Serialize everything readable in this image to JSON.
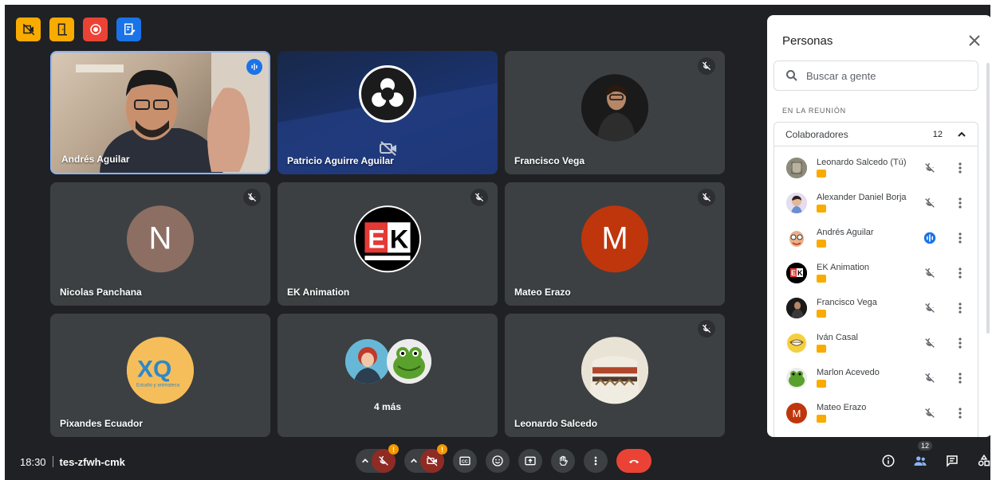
{
  "colors": {
    "tile_bg": "#3c4043",
    "meet_bg": "#202124",
    "accent_blue": "#1a73e8",
    "hangup_red": "#ea4335",
    "mic_off_red": "#8e2b25",
    "badge_orange": "#f29900",
    "host_yellow": "#f9ab00"
  },
  "host_tools": [
    {
      "icon": "hide-video-icon",
      "color": "#f9ab00"
    },
    {
      "icon": "exit-door-icon",
      "color": "#f9ab00"
    },
    {
      "icon": "record-icon",
      "color": "#ea4335"
    },
    {
      "icon": "notes-edit-icon",
      "color": "#1a73e8"
    }
  ],
  "tiles": [
    {
      "name": "Andrés Aguilar",
      "type": "video",
      "speaking": true
    },
    {
      "name": "Patricio Aguirre Aguilar",
      "type": "obs",
      "camera_off_icon": "camera-off-icon"
    },
    {
      "name": "Francisco Vega",
      "type": "photo",
      "muted": true
    },
    {
      "name": "Nicolas Panchana",
      "type": "letter",
      "letter": "N",
      "avatar_color": "#8d6e63",
      "muted": true
    },
    {
      "name": "EK Animation",
      "type": "logo",
      "logo_text": "EK",
      "muted": true
    },
    {
      "name": "Mateo Erazo",
      "type": "letter",
      "letter": "M",
      "avatar_color": "#bf360c",
      "muted": true
    },
    {
      "name": "Pixandes Ecuador",
      "type": "logo",
      "logo_text": "XQ",
      "logo_sub": "Estudio y animateca"
    },
    {
      "name": "",
      "type": "more",
      "more_label": "4 más"
    },
    {
      "name": "Leonardo Salcedo",
      "type": "photo",
      "muted": true
    }
  ],
  "panel": {
    "title": "Personas",
    "close_icon": "close-icon",
    "search_placeholder": "Buscar a gente",
    "section_label": "EN LA REUNIÓN",
    "group_label": "Colaboradores",
    "group_count": "12",
    "people": [
      {
        "name": "Leonardo Salcedo (Tú)",
        "mic": "muted"
      },
      {
        "name": "Alexander Daniel Borja",
        "mic": "muted"
      },
      {
        "name": "Andrés Aguilar",
        "mic": "speaking"
      },
      {
        "name": "EK Animation",
        "mic": "muted"
      },
      {
        "name": "Francisco Vega",
        "mic": "muted"
      },
      {
        "name": "Iván Casal",
        "mic": "muted"
      },
      {
        "name": "Marlon Acevedo",
        "mic": "muted"
      },
      {
        "name": "Mateo Erazo",
        "mic": "muted",
        "letter": "M",
        "avatar_color": "#bf360c"
      }
    ]
  },
  "bottom": {
    "time": "18:30",
    "meeting_code": "tes-zfwh-cmk",
    "mic_warning": "!",
    "cam_warning": "!",
    "people_count": "12"
  }
}
